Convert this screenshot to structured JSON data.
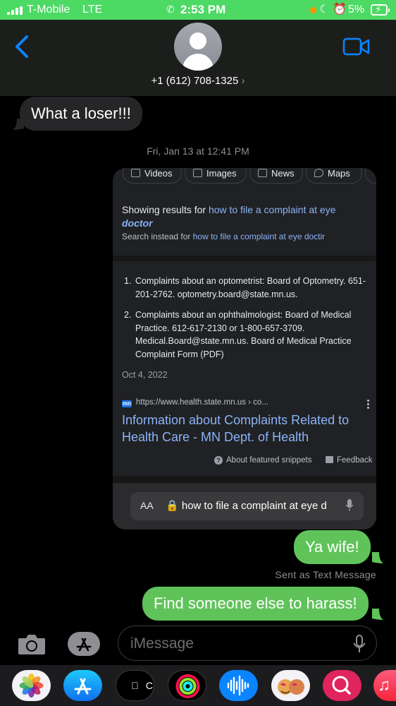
{
  "status_bar": {
    "carrier": "T-Mobile",
    "network": "LTE",
    "time": "2:53 PM",
    "battery_percent": "5%",
    "colors": {
      "background": "#4cd964"
    }
  },
  "header": {
    "back_icon": "chevron-left-icon",
    "contact_name": "+1 (612) 708-1325",
    "contact_chevron": "›",
    "video_icon": "facetime-video-icon",
    "accent_color": "#0a84ff"
  },
  "messages": {
    "incoming_1": "What a loser!!!",
    "timestamp_day": "Fri, Jan 13",
    "timestamp_time": "12:41 PM",
    "outgoing_1": "Ya wife!",
    "sent_as": "Sent as Text Message",
    "outgoing_2": "Find someone else to harass!",
    "colors": {
      "incoming": "#262628",
      "outgoing": "#5fc35a"
    }
  },
  "screenshot": {
    "chips": [
      "Videos",
      "Images",
      "News",
      "Maps"
    ],
    "showing_prefix": "Showing results for",
    "showing_query": "how to file a complaint at eye",
    "showing_bold": "doctor",
    "search_instead_prefix": "Search instead for",
    "search_instead_query": "how to file a complaint at eye doctir",
    "list": [
      {
        "num": "1.",
        "text": "Complaints about an optometrist: Board of Optometry. 651-201-2762. optometry.board@state.mn.us."
      },
      {
        "num": "2.",
        "text": "Complaints about an ophthalmologist: Board of Medical Practice. 612-617-2130 or 1-800-657-3709. Medical.Board@state.mn.us. Board of Medical Practice Complaint Form (PDF)"
      }
    ],
    "date": "Oct 4, 2022",
    "favicon_text": "mn",
    "source_url": "https://www.health.state.mn.us › co...",
    "result_title": "Information about Complaints Related to Health Care - MN Dept. of Health",
    "about_snippets": "About featured snippets",
    "feedback": "Feedback",
    "address_aa": "AA",
    "address_text": "how to file a complaint at eye d"
  },
  "input_bar": {
    "placeholder": "iMessage",
    "camera_icon": "camera-icon",
    "appstore_icon": "app-store-icon",
    "mic_icon": "microphone-icon"
  },
  "app_drawer": {
    "apps": [
      {
        "name": "photos-app-icon"
      },
      {
        "name": "app-store-app-icon"
      },
      {
        "name": "cash-app-icon",
        "label": "Cash"
      },
      {
        "name": "fitness-activity-app-icon"
      },
      {
        "name": "audio-message-app-icon"
      },
      {
        "name": "memoji-app-icon"
      },
      {
        "name": "search-images-app-icon"
      },
      {
        "name": "music-app-icon"
      }
    ]
  }
}
